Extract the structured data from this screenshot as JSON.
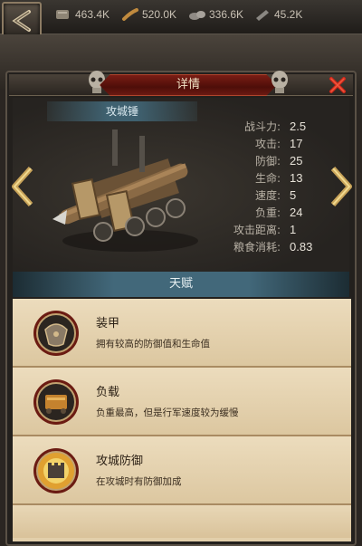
{
  "resources": [
    {
      "icon": "food-icon",
      "value": "463.4K"
    },
    {
      "icon": "wood-icon",
      "value": "520.0K"
    },
    {
      "icon": "stone-icon",
      "value": "336.6K"
    },
    {
      "icon": "iron-icon",
      "value": "45.2K"
    }
  ],
  "panel": {
    "title": "详情"
  },
  "unit": {
    "name": "攻城锤",
    "stats": [
      {
        "label": "战斗力:",
        "value": "2.5"
      },
      {
        "label": "攻击:",
        "value": "17"
      },
      {
        "label": "防御:",
        "value": "25"
      },
      {
        "label": "生命:",
        "value": "13"
      },
      {
        "label": "速度:",
        "value": "5"
      },
      {
        "label": "负重:",
        "value": "24"
      },
      {
        "label": "攻击距离:",
        "value": "1"
      },
      {
        "label": "粮食消耗:",
        "value": "0.83"
      }
    ]
  },
  "talents": {
    "header": "天赋",
    "items": [
      {
        "name": "装甲",
        "desc": "拥有较高的防御值和生命值",
        "icon": "armor-icon"
      },
      {
        "name": "负载",
        "desc": "负重最高，但是行军速度较为缓慢",
        "icon": "load-icon"
      },
      {
        "name": "攻城防御",
        "desc": "在攻城时有防御加成",
        "icon": "siege-defense-icon"
      }
    ]
  }
}
